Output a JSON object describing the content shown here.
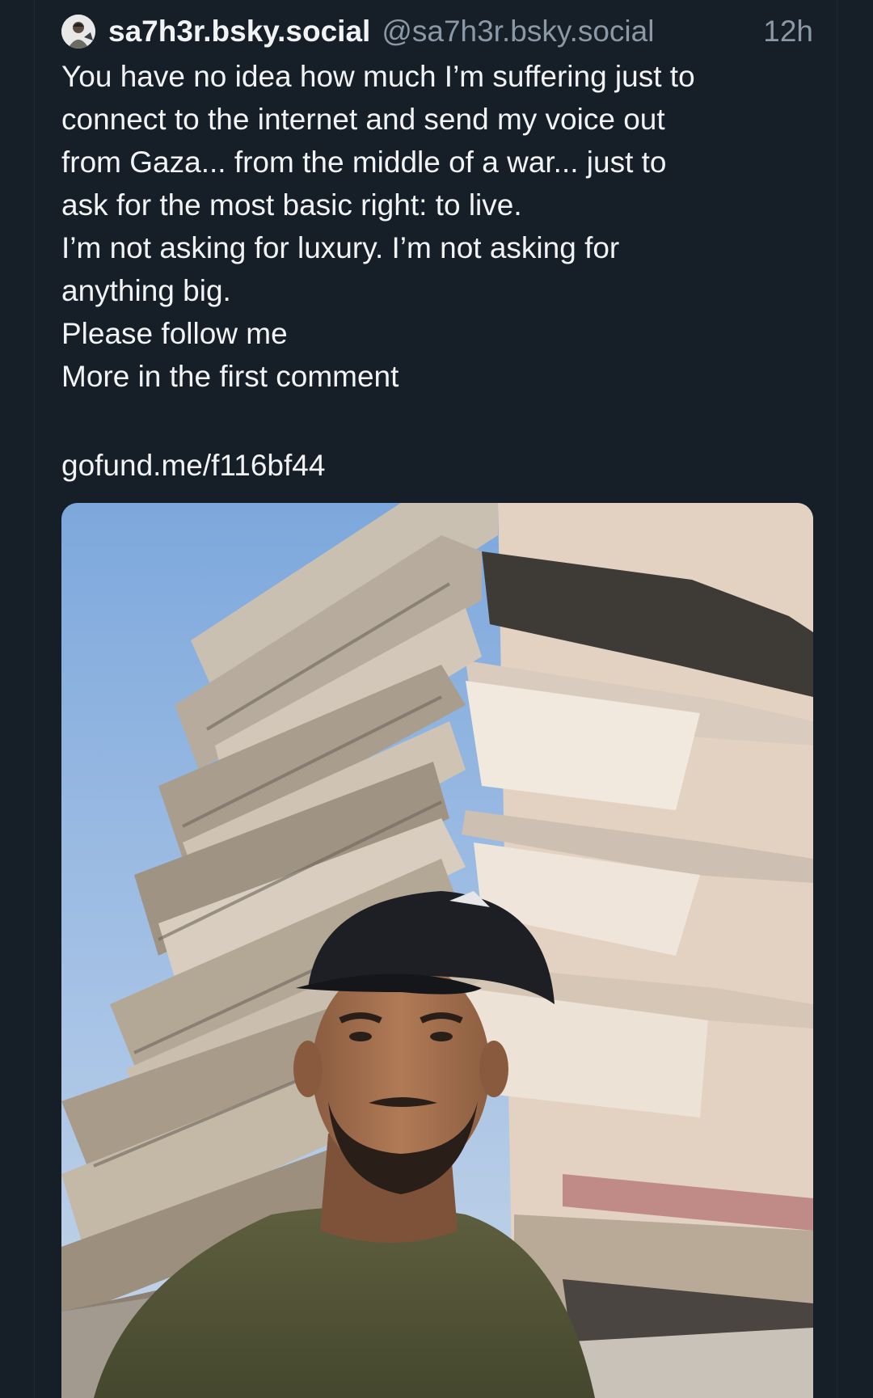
{
  "post": {
    "display_name": "sa7h3r.bsky.social",
    "handle": "@sa7h3r.bsky.social",
    "timestamp": "12h",
    "avatar": "avatar-photo",
    "text_lines": [
      "You have no idea how much I’m suffering just to",
      "connect to the internet and send my voice out",
      "from Gaza... from the middle of a war... just to",
      "ask for the most basic right: to live.",
      "I’m not asking for luxury. I’m not asking for",
      "anything big.",
      "Please follow me",
      "More in the first comment"
    ],
    "link": "gofund.me/f116bf44",
    "image": "photo of a man in a black cap in front of a collapsed multi-storey building"
  },
  "colors": {
    "background": "#161e27",
    "text": "#f1f3f5",
    "muted": "#8b98a5"
  }
}
